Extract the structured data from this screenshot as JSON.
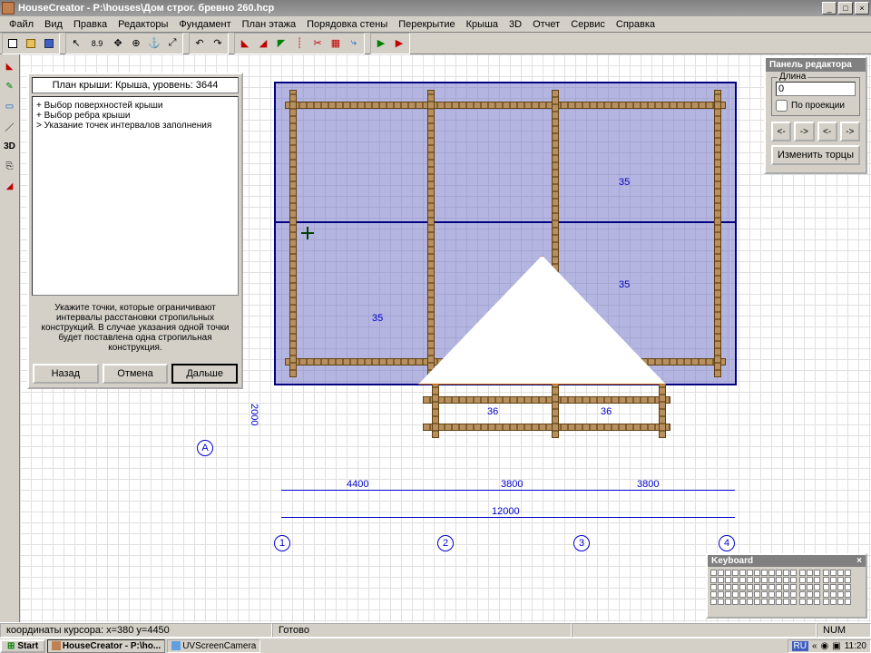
{
  "window": {
    "title": "HouseCreator - P:\\houses\\Дом строг. бревно 260.hcp",
    "btn_min": "_",
    "btn_max": "□",
    "btn_close": "×"
  },
  "menu": {
    "file": "Файл",
    "view": "Вид",
    "edit": "Правка",
    "editors": "Редакторы",
    "foundation": "Фундамент",
    "floorplan": "План этажа",
    "wallorder": "Порядовка стены",
    "overlap": "Перекрытие",
    "roof": "Крыша",
    "threeD": "3D",
    "report": "Отчет",
    "service": "Сервис",
    "help": "Справка"
  },
  "toolbar": {
    "snap89": "8.9"
  },
  "lefttools": {
    "threeD": "3D"
  },
  "taskpanel": {
    "header": "План крыши: Крыша, уровень: 3644",
    "step1": "+ Выбор поверхностей крыши",
    "step2": "+ Выбор ребра крыши",
    "step3": "> Указание точек интервалов заполнения",
    "hint": "Укажите точки, которые ограничивают интервалы расстановки стропильных конструкций. В случае указания одной точки будет поставлена одна стропильная конструкция.",
    "back": "Назад",
    "cancel": "Отмена",
    "next": "Дальше"
  },
  "editpanel": {
    "title": "Панель редактора",
    "length_label": "Длина",
    "length_value": "0",
    "projection": "По проекции",
    "left": "<-",
    "right": "->",
    "change_ends": "Изменить торцы"
  },
  "drawing": {
    "roof_label_35a": "35",
    "roof_label_35b": "35",
    "roof_label_35c": "35",
    "gable_dim_36a": "36",
    "gable_dim_36b": "36",
    "dim_2000": "2000",
    "dim_4400": "4400",
    "dim_3800a": "3800",
    "dim_3800b": "3800",
    "dim_12000": "12000",
    "axis_A": "А",
    "axis_1": "1",
    "axis_2": "2",
    "axis_3": "3",
    "axis_4": "4"
  },
  "keyboard": {
    "title": "Keyboard",
    "close": "×"
  },
  "status": {
    "coords": "координаты курсора: x=380 y=4450",
    "ready": "Готово",
    "num": "NUM"
  },
  "taskbar": {
    "start": "Start",
    "app1": "HouseCreator - P:\\ho...",
    "app2": "UVScreenCamera",
    "lang": "RU",
    "arrows": "«",
    "time": "11:20"
  }
}
